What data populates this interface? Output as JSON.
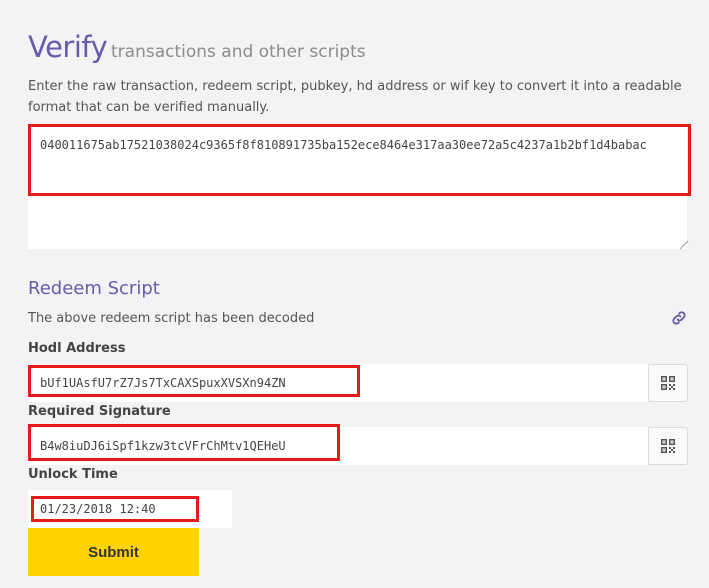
{
  "header": {
    "title": "Verify",
    "subtitle": "transactions and other scripts",
    "description": "Enter the raw transaction, redeem script, pubkey, hd address or wif key to convert it into a readable format that can be verified manually."
  },
  "input": {
    "value": "040011675ab17521038024c9365f8f810891735ba152ece8464e317aa30ee72a5c4237a1b2bf1d4babac"
  },
  "redeem": {
    "title": "Redeem Script",
    "note": "The above redeem script has been decoded",
    "link_icon": "link-icon",
    "hodl_label": "Hodl Address",
    "hodl_value": "bUf1UAsfU7rZ7Js7TxCAXSpuxXVSXn94ZN",
    "sig_label": "Required Signature",
    "sig_value": "B4w8iuDJ6iSpf1kzw3tcVFrChMtv1QEHeU",
    "unlock_label": "Unlock Time",
    "unlock_value": "01/23/2018 12:40",
    "qr_icon": "qr-code-icon"
  },
  "submit": {
    "label": "Submit"
  },
  "colors": {
    "accent": "#6a5aa8",
    "highlight": "#e31b1b",
    "button": "#ffd200"
  }
}
